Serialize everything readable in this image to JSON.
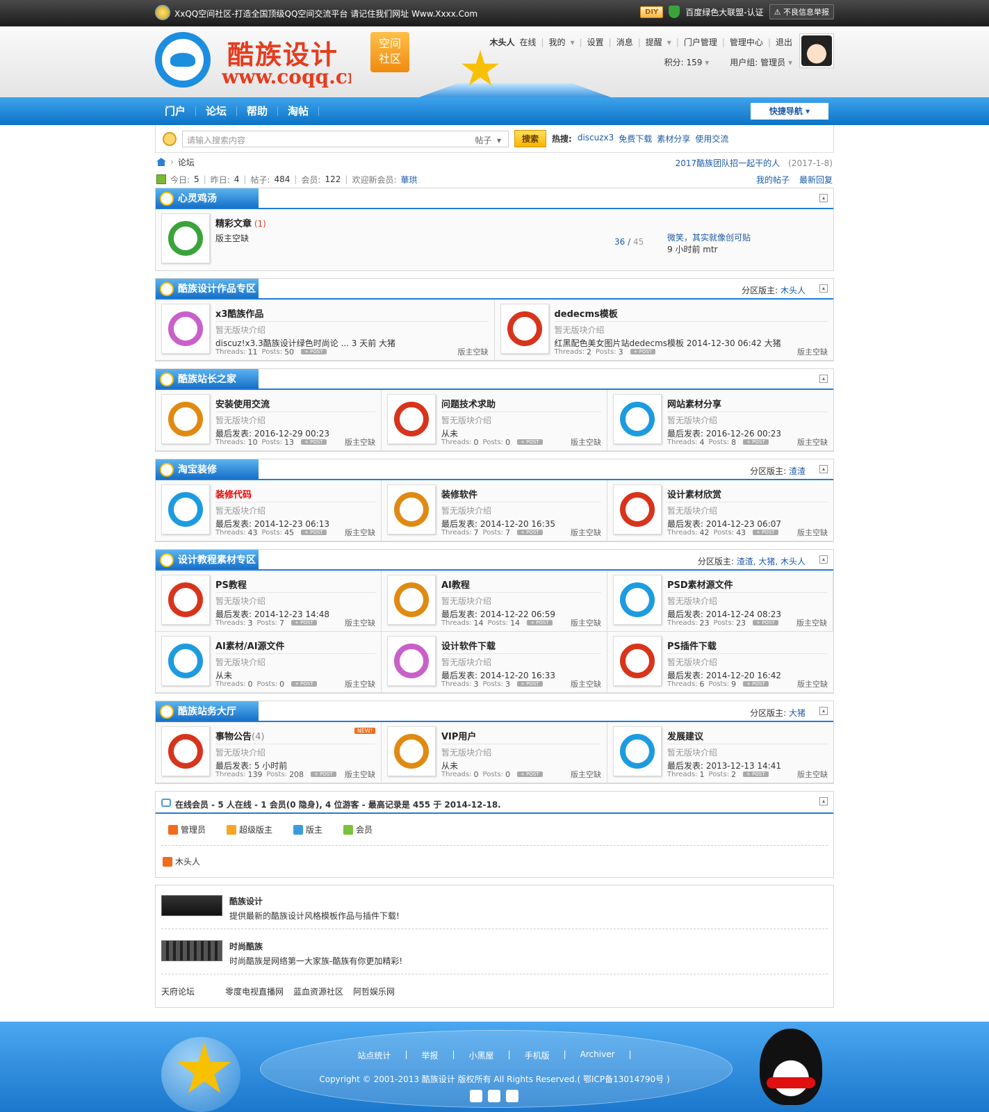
{
  "topbar": {
    "text": "XxQQ空间社区-打造全国顶级QQ空间交流平台 请记住我们网址 Www.Xxxx.Com",
    "diy": "DIY",
    "union": "百度绿色大联盟-认证",
    "report": "不良信息举报"
  },
  "header": {
    "logo_title": "酷族设计",
    "logo_url": "www.coqq.cn",
    "badge_line1": "空间",
    "badge_line2": "社区",
    "user": {
      "name": "木头人",
      "status": "在线",
      "menu": [
        "我的",
        "设置",
        "消息",
        "提醒",
        "门户管理",
        "管理中心",
        "退出"
      ],
      "points_label": "积分: 159",
      "group_label": "用户组: 管理员"
    }
  },
  "nav": {
    "items": [
      "门户",
      "论坛",
      "帮助",
      "淘帖"
    ],
    "quick": "快捷导航"
  },
  "search": {
    "placeholder": "请输入搜索内容",
    "type": "帖子",
    "button": "搜索",
    "hot_label": "热搜:",
    "hot": [
      "discuzx3",
      "免费下载",
      "素材分享",
      "使用交流"
    ]
  },
  "crumb": {
    "current": "论坛",
    "notice": "2017酷族团队招一起干的人",
    "notice_date": "(2017-1-8)"
  },
  "stats": {
    "today_l": "今日:",
    "today": "5",
    "yest_l": "昨日:",
    "yest": "4",
    "posts_l": "帖子:",
    "posts": "484",
    "members_l": "会员:",
    "members": "122",
    "welcome_l": "欢迎新会员:",
    "welcome": "華珙",
    "my_posts": "我的帖子",
    "latest": "最新回复"
  },
  "cat1": {
    "title": "心灵鸡汤",
    "forum": "精彩文章",
    "count": "(1)",
    "mod": "版主空缺",
    "threads": "36",
    "posts": "45",
    "last_title": "微笑，其实就像创可贴",
    "last_meta": "9 小时前 mtr"
  },
  "cat2": {
    "title": "酷族设计作品专区",
    "mod_label": "分区版主:",
    "mod": "木头人",
    "forums": [
      {
        "name": "x3酷族作品",
        "desc": "暂无版块介绍",
        "last": "discuz!x3.3酷族设计绿色时尚论 ... 3 天前 大猪",
        "threads": "11",
        "posts": "50",
        "mod": "版主空缺",
        "color": "#c960c9"
      },
      {
        "name": "dedecms模板",
        "desc": "暂无版块介绍",
        "last": "红黑配色美女图片站dedecms模板 2014-12-30 06:42 大猪",
        "threads": "2",
        "posts": "3",
        "mod": "版主空缺",
        "color": "#d8341c"
      }
    ]
  },
  "cat3": {
    "title": "酷族站长之家",
    "forums": [
      {
        "name": "安装使用交流",
        "desc": "暂无版块介绍",
        "last": "最后发表: 2016-12-29 00:23",
        "threads": "10",
        "posts": "13",
        "mod": "版主空缺",
        "color": "#e08a12"
      },
      {
        "name": "问题技术求助",
        "desc": "暂无版块介绍",
        "last": "从未",
        "threads": "0",
        "posts": "0",
        "mod": "版主空缺",
        "color": "#d8341c"
      },
      {
        "name": "网站素材分享",
        "desc": "暂无版块介绍",
        "last": "最后发表: 2016-12-26 00:23",
        "threads": "4",
        "posts": "8",
        "mod": "版主空缺",
        "color": "#1c9be0"
      }
    ]
  },
  "cat4": {
    "title": "淘宝装修",
    "mod_label": "分区版主:",
    "mod": "渣渣",
    "forums": [
      {
        "name": "装修代码",
        "desc": "暂无版块介绍",
        "last": "最后发表: 2014-12-23 06:13",
        "threads": "43",
        "posts": "45",
        "mod": "版主空缺",
        "color": "#1c9be0"
      },
      {
        "name": "装修软件",
        "desc": "暂无版块介绍",
        "last": "最后发表: 2014-12-20 16:35",
        "threads": "7",
        "posts": "7",
        "mod": "版主空缺",
        "color": "#e08a12"
      },
      {
        "name": "设计素材欣赏",
        "desc": "暂无版块介绍",
        "last": "最后发表: 2014-12-23 06:07",
        "threads": "42",
        "posts": "43",
        "mod": "版主空缺",
        "color": "#d8341c"
      }
    ]
  },
  "cat5": {
    "title": "设计教程素材专区",
    "mod_label": "分区版主:",
    "mod": "渣渣, 大猪, 木头人",
    "forums": [
      {
        "name": "PS教程",
        "desc": "暂无版块介绍",
        "last": "最后发表: 2014-12-23 14:48",
        "threads": "3",
        "posts": "7",
        "mod": "版主空缺",
        "color": "#d8341c"
      },
      {
        "name": "AI教程",
        "desc": "暂无版块介绍",
        "last": "最后发表: 2014-12-22 06:59",
        "threads": "14",
        "posts": "14",
        "mod": "版主空缺",
        "color": "#e08a12"
      },
      {
        "name": "PSD素材源文件",
        "desc": "暂无版块介绍",
        "last": "最后发表: 2014-12-24 08:23",
        "threads": "23",
        "posts": "23",
        "mod": "版主空缺",
        "color": "#1c9be0"
      },
      {
        "name": "AI素材/AI源文件",
        "desc": "暂无版块介绍",
        "last": "从未",
        "threads": "0",
        "posts": "0",
        "mod": "版主空缺",
        "color": "#1c9be0"
      },
      {
        "name": "设计软件下载",
        "desc": "暂无版块介绍",
        "last": "最后发表: 2014-12-20 16:33",
        "threads": "3",
        "posts": "3",
        "mod": "版主空缺",
        "color": "#c960c9"
      },
      {
        "name": "PS插件下载",
        "desc": "暂无版块介绍",
        "last": "最后发表: 2014-12-20 16:42",
        "threads": "6",
        "posts": "9",
        "mod": "版主空缺",
        "color": "#d8341c"
      }
    ]
  },
  "cat6": {
    "title": "酷族站务大厅",
    "mod_label": "分区版主:",
    "mod": "大猪",
    "forums": [
      {
        "name": "事物公告",
        "count": "(4)",
        "desc": "暂无版块介绍",
        "last": "最后发表: 5 小时前",
        "threads": "139",
        "posts": "208",
        "mod": "版主空缺",
        "color": "#d8341c",
        "new": "NEW!"
      },
      {
        "name": "VIP用户",
        "desc": "暂无版块介绍",
        "last": "从未",
        "threads": "0",
        "posts": "0",
        "mod": "版主空缺",
        "color": "#e08a12"
      },
      {
        "name": "发展建议",
        "desc": "暂无版块介绍",
        "last": "最后发表: 2013-12-13 14:41",
        "threads": "1",
        "posts": "2",
        "mod": "版主空缺",
        "color": "#1c9be0"
      }
    ]
  },
  "labels": {
    "threads": "Threads:",
    "posts": "Posts:",
    "post_tag": "+ POST"
  },
  "online": {
    "title": "在线会员 - 5 人在线 - 1 会员(0 隐身), 4 位游客 - 最高记录是 455 于 2014-12-18.",
    "legend": [
      "管理员",
      "超级版主",
      "版主",
      "会员"
    ],
    "user": "木头人"
  },
  "links": {
    "items": [
      {
        "name": "酷族设计",
        "desc": "提供最新的酷族设计风格模板作品与插件下载!"
      },
      {
        "name": "时尚酷族",
        "desc": "时尚酷族是网络第一大家族-酷族有你更加精彩!"
      }
    ],
    "text": [
      "天府论坛",
      "零度电视直播网",
      "蓝血资源社区",
      "阿哲娱乐网"
    ]
  },
  "footer": {
    "links": [
      "站点统计",
      "举报",
      "小黑屋",
      "手机版",
      "Archiver"
    ],
    "copyright": "Copyright © 2001-2013 酷族设计 版权所有 All Rights Reserved.( 鄂ICP备13014790号 )"
  }
}
